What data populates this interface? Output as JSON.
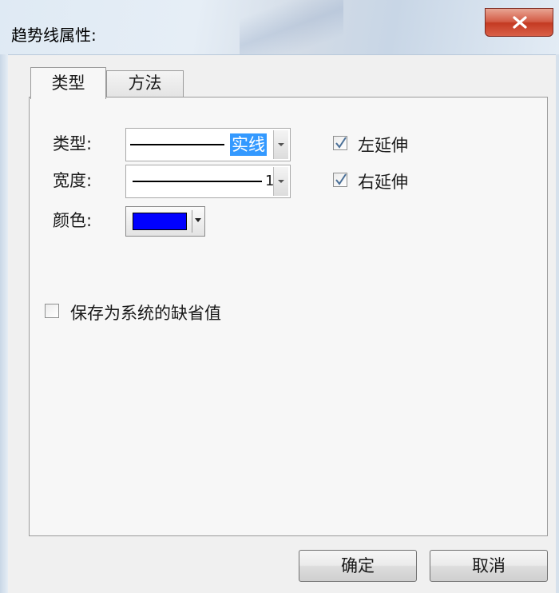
{
  "window": {
    "title": "趋势线属性:"
  },
  "tabs": [
    {
      "label": "类型"
    },
    {
      "label": "方法"
    }
  ],
  "fields": {
    "type_label": "类型:",
    "type_value": "实线",
    "width_label": "宽度:",
    "width_value": "1",
    "color_label": "颜色:",
    "color_value": "#0000ff"
  },
  "options": {
    "extend_left": {
      "label": "左延伸",
      "checked": true
    },
    "extend_right": {
      "label": "右延伸",
      "checked": true
    },
    "save_default": {
      "label": "保存为系统的缺省值",
      "checked": false
    }
  },
  "buttons": {
    "ok": "确定",
    "cancel": "取消"
  },
  "icons": {
    "close": "close-x-icon",
    "dropdown": "chevron-down-icon",
    "check": "checkmark-icon"
  }
}
